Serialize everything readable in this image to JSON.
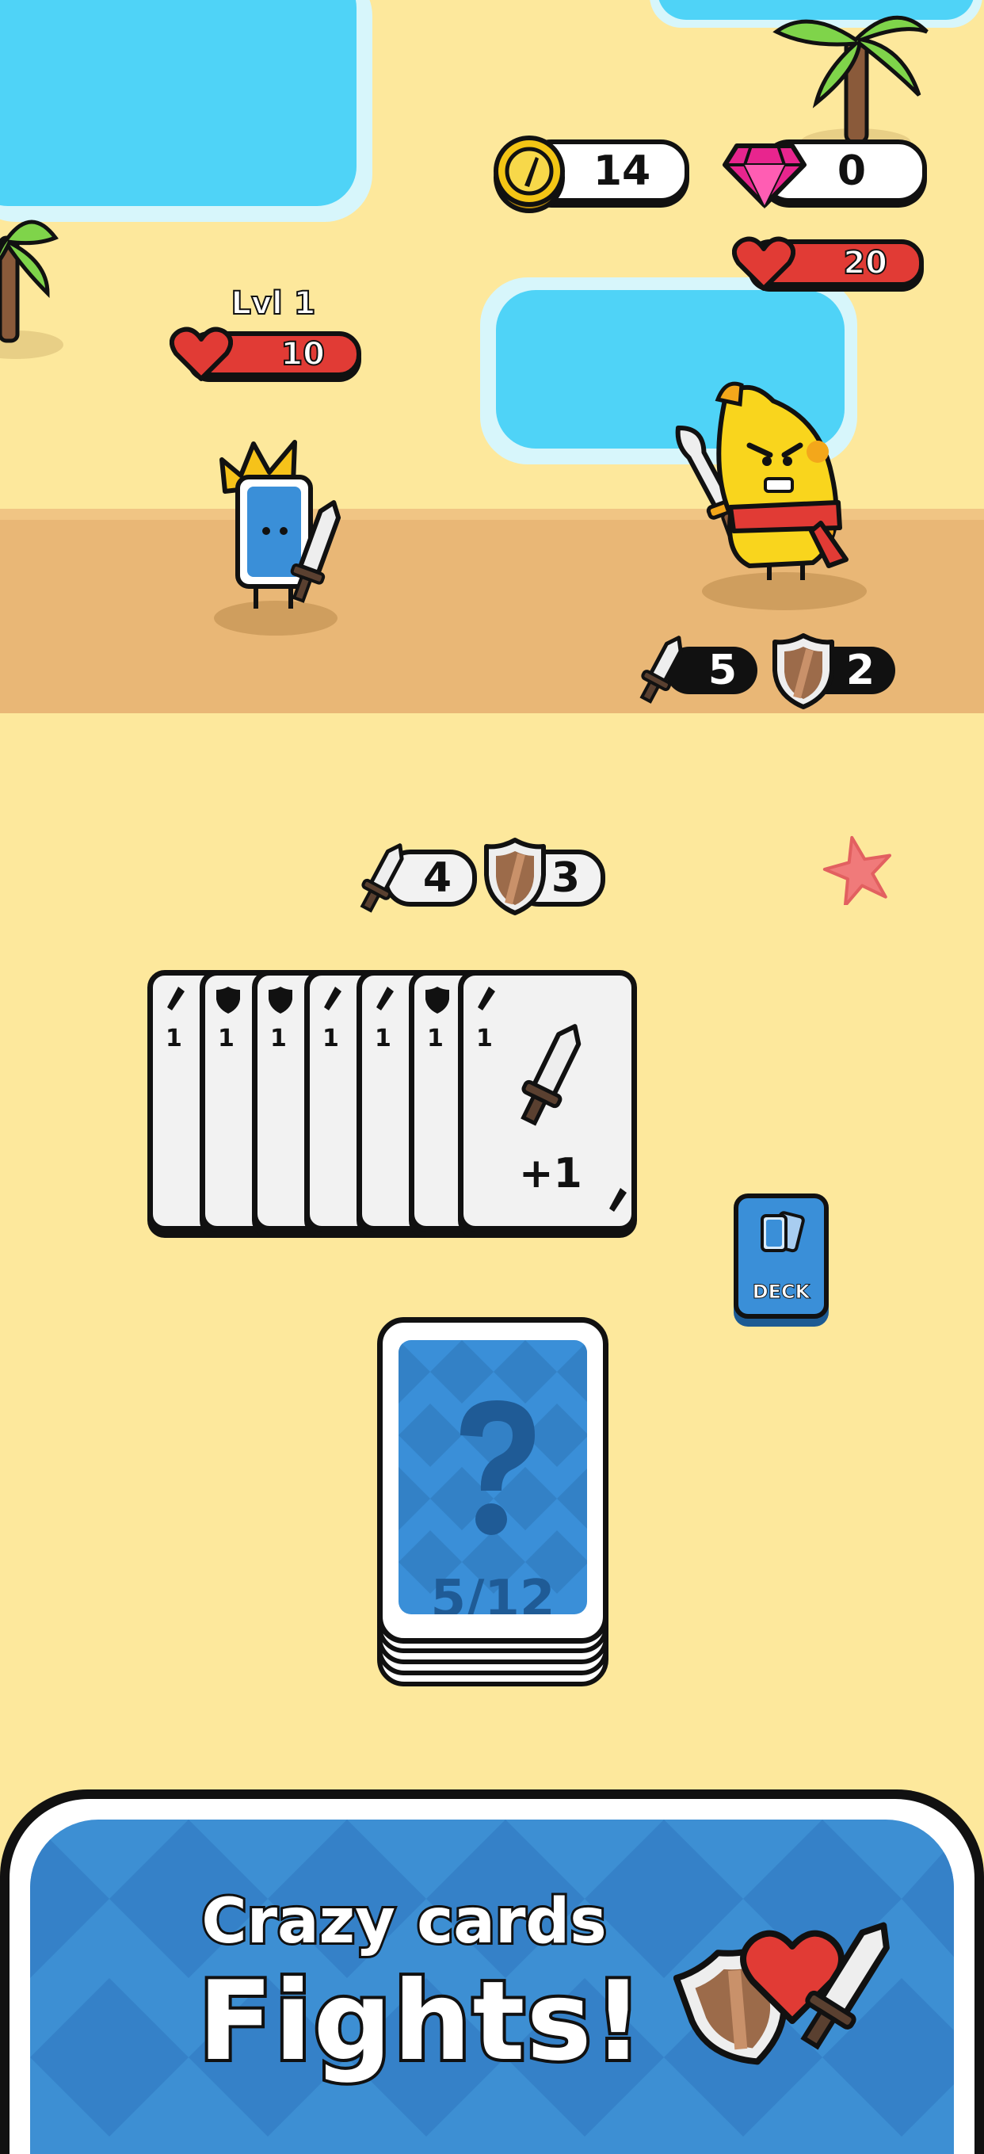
{
  "resources": {
    "coins": "14",
    "gems": "0"
  },
  "player": {
    "level": "Lvl 1",
    "hp": "10"
  },
  "enemy": {
    "hp": "20",
    "attack": "5",
    "defense": "2"
  },
  "hand_stats": {
    "attack": "4",
    "defense": "3"
  },
  "hand_cards": [
    {
      "type": "attack",
      "value": "1"
    },
    {
      "type": "defense",
      "value": "1"
    },
    {
      "type": "defense",
      "value": "1"
    },
    {
      "type": "attack",
      "value": "1"
    },
    {
      "type": "attack",
      "value": "1"
    },
    {
      "type": "defense",
      "value": "1"
    },
    {
      "type": "attack",
      "value": "1",
      "bonus": "+1"
    }
  ],
  "deck_button": {
    "label": "DECK"
  },
  "draw_pile": {
    "count": "5/12"
  },
  "banner": {
    "line1": "Crazy cards",
    "line2": "Fights!"
  },
  "colors": {
    "sand": "#fde89c",
    "path": "#e9b776",
    "water": "#4fd3f7",
    "hp_red": "#e13b35",
    "card_blue": "#3a8fd8"
  },
  "icons": [
    "coin-icon",
    "gem-icon",
    "heart-icon",
    "sword-icon",
    "shield-icon",
    "palm-tree",
    "starfish",
    "question-mark"
  ]
}
